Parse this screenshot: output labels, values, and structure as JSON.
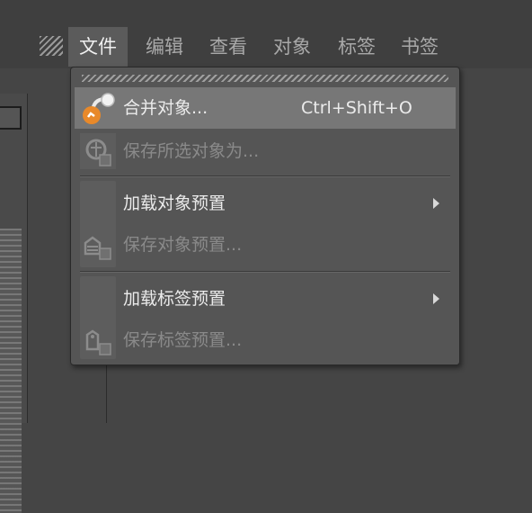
{
  "menubar": {
    "items": [
      {
        "label": "文件",
        "active": true
      },
      {
        "label": "编辑"
      },
      {
        "label": "查看"
      },
      {
        "label": "对象"
      },
      {
        "label": "标签"
      },
      {
        "label": "书签"
      }
    ]
  },
  "file_menu": {
    "items": [
      {
        "label": "合并对象...",
        "shortcut": "Ctrl+Shift+O",
        "icon": "merge-objects-icon",
        "highlighted": true
      },
      {
        "label": "保存所选对象为...",
        "icon": "save-selected-icon",
        "enabled": false
      },
      {
        "label": "加载对象预置",
        "submenu": true
      },
      {
        "label": "保存对象预置...",
        "icon": "save-object-preset-icon",
        "enabled": false
      },
      {
        "label": "加载标签预置",
        "submenu": true
      },
      {
        "label": "保存标签预置...",
        "icon": "save-tag-preset-icon",
        "enabled": false
      }
    ]
  },
  "colors": {
    "background": "#454545",
    "menu_bg": "#555555",
    "highlight": "#777777",
    "accent": "#e8892a"
  }
}
